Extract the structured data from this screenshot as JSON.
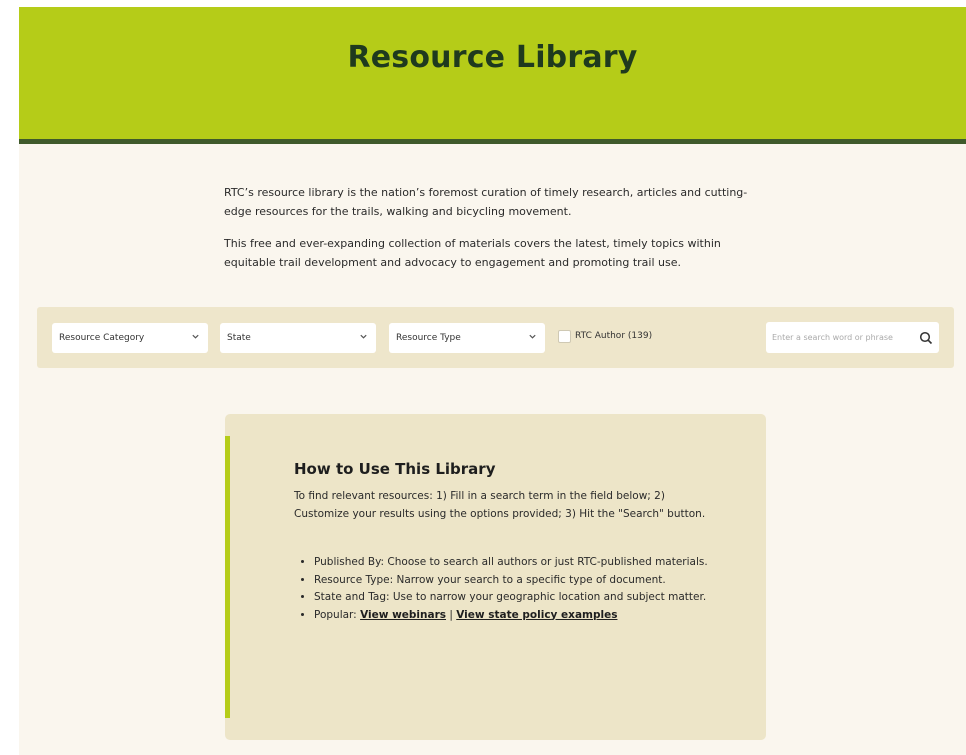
{
  "hero": {
    "title": "Resource Library"
  },
  "intro": {
    "p1": "RTC’s resource library is the nation’s foremost curation of timely research, articles and cutting-edge resources for the trails, walking and bicycling movement.",
    "p2": "This free and ever-expanding collection of materials covers the latest, timely topics within equitable trail development and advocacy to engagement and promoting trail use."
  },
  "filters": {
    "category": "Resource Category",
    "state": "State",
    "type": "Resource Type",
    "rtc_author": "RTC Author (139)",
    "search_placeholder": "Enter a search word or phrase"
  },
  "howto": {
    "title": "How to Use This Library",
    "lead": "To find relevant resources: 1) Fill in a search term in the field below; 2) Customize your results using the options provided; 3) Hit the \"Search\" button.",
    "items": [
      "Published By: Choose to search all authors or just RTC-published materials.",
      "Resource Type: Narrow your search to a specific type of document.",
      "State and Tag: Use to narrow your geographic location and subject matter."
    ],
    "popular_prefix": "Popular: ",
    "link_webinars": "View webinars",
    "separator": " | ",
    "link_policy": "View state policy examples"
  },
  "colors": {
    "hero": "#b5cc18",
    "hero_border": "#3f5a2b",
    "panel": "#ede5c8"
  }
}
